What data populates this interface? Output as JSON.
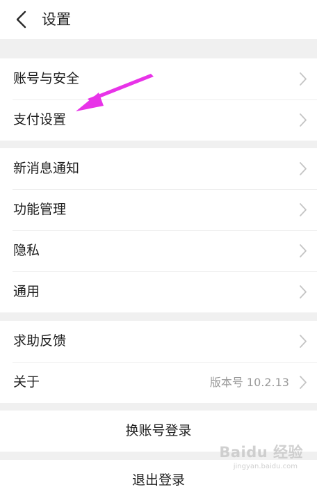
{
  "header": {
    "back_icon": "chevron-left-icon",
    "title": "设置"
  },
  "groups": [
    {
      "items": [
        {
          "label": "账号与安全"
        },
        {
          "label": "支付设置"
        }
      ]
    },
    {
      "items": [
        {
          "label": "新消息通知"
        },
        {
          "label": "功能管理"
        },
        {
          "label": "隐私"
        },
        {
          "label": "通用"
        }
      ]
    },
    {
      "items": [
        {
          "label": "求助反馈"
        },
        {
          "label": "关于",
          "value": "版本号 10.2.13"
        }
      ]
    }
  ],
  "actions": {
    "switch_account": "换账号登录",
    "logout": "退出登录"
  },
  "annotation": {
    "color": "#e833e8"
  },
  "watermark": {
    "brand": "Baidu 经验",
    "url": "jingyan.baidu.com"
  },
  "colors": {
    "background": "#f0f0f0",
    "surface": "#ffffff",
    "divider": "#ececec",
    "secondary_text": "#9a9a9a",
    "chevron": "#c4c4c4"
  }
}
